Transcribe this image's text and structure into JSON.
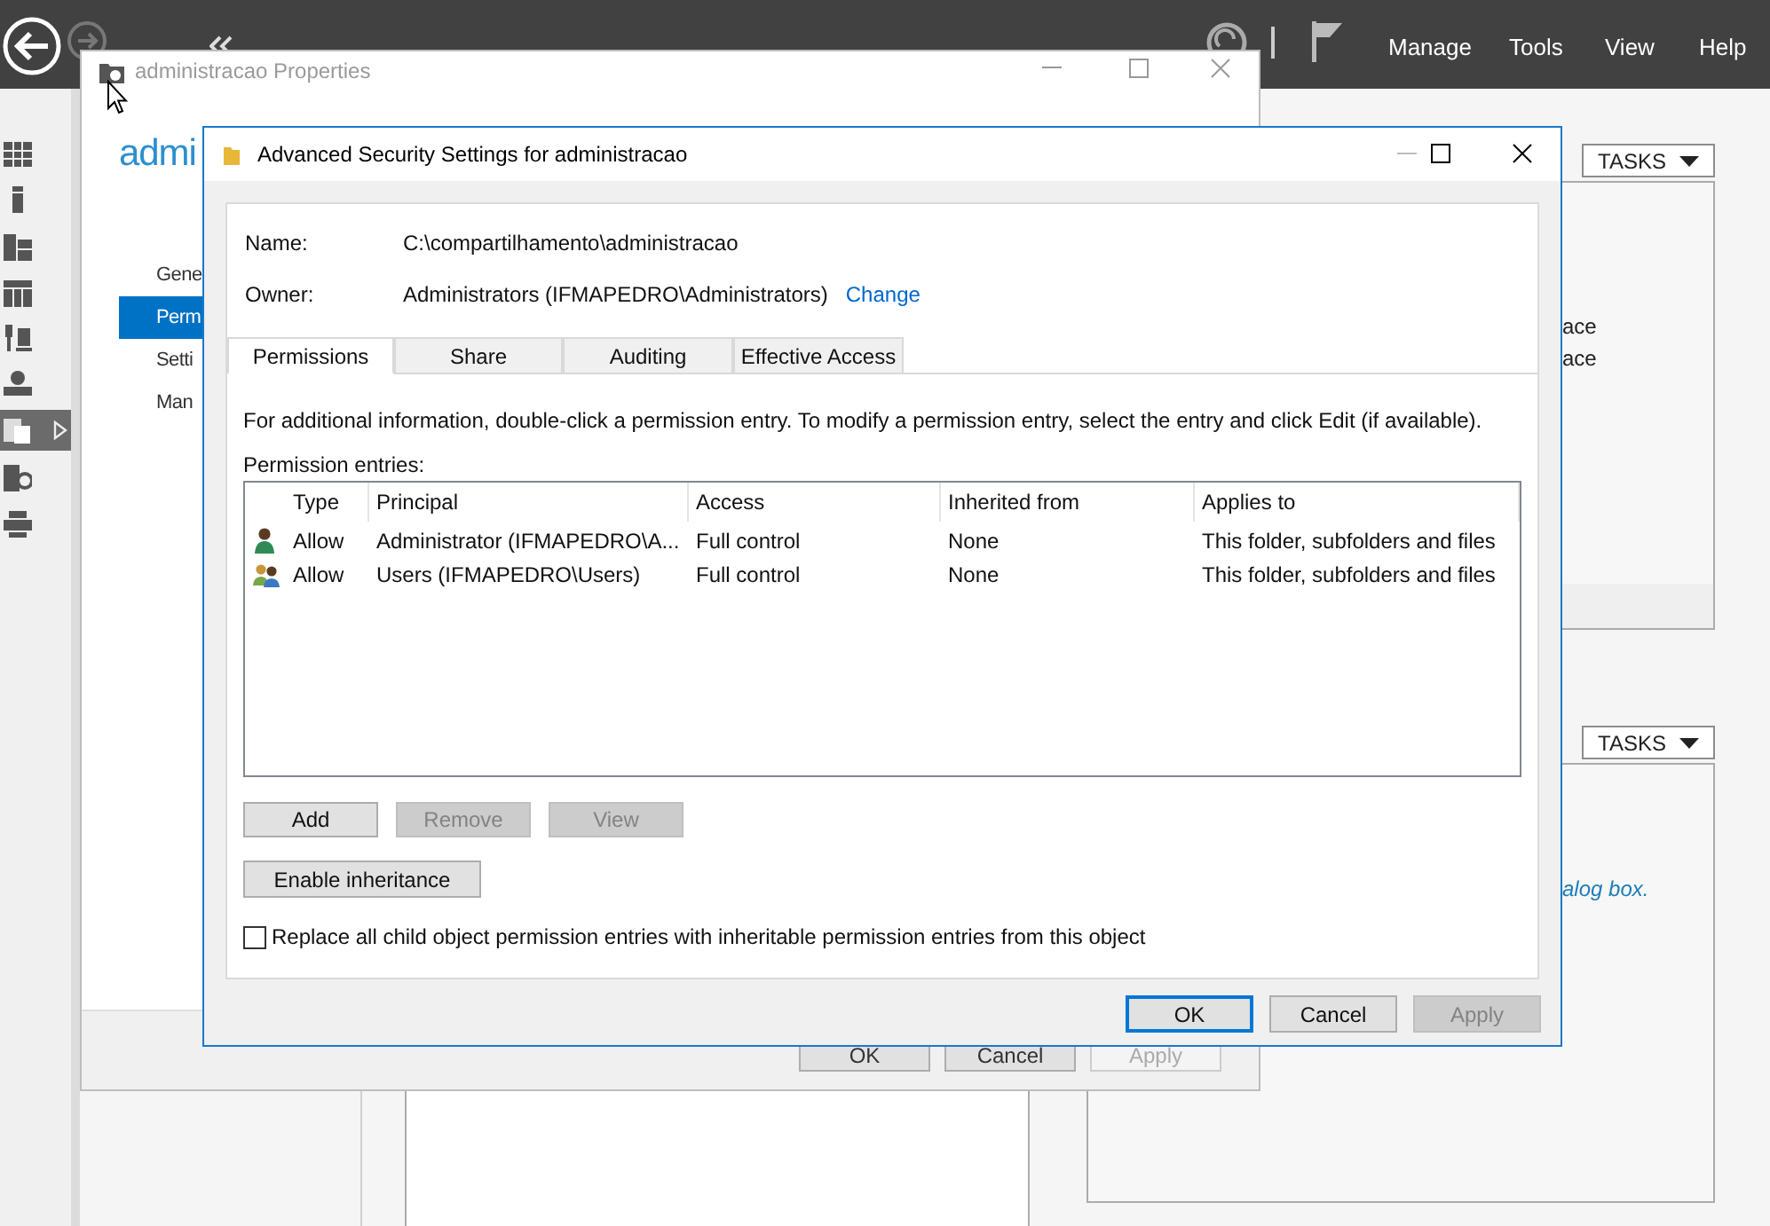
{
  "top_bar": {
    "menu": [
      "Manage",
      "Tools",
      "View",
      "Help"
    ]
  },
  "sidebar": {
    "items": [
      {
        "selected": false
      },
      {
        "selected": false
      },
      {
        "selected": false
      },
      {
        "selected": false
      },
      {
        "selected": false
      },
      {
        "selected": false
      },
      {
        "selected": true
      },
      {
        "selected": false
      },
      {
        "selected": false
      }
    ]
  },
  "right_panels": [
    {
      "tasks": "TASKS",
      "texts": [
        "ace",
        "ace"
      ],
      "kind": "text"
    },
    {
      "tasks": "TASKS",
      "texts": [
        "alog box."
      ],
      "kind": "link"
    }
  ],
  "properties_window": {
    "title": "administracao Properties",
    "active": false,
    "heading": "admi",
    "nav": [
      {
        "label": "Gene",
        "selected": false
      },
      {
        "label": "Perm",
        "selected": true
      },
      {
        "label": "Setti",
        "selected": false
      },
      {
        "label": "Man",
        "selected": false
      }
    ],
    "buttons": [
      {
        "label": "OK",
        "disabled": false
      },
      {
        "label": "Cancel",
        "disabled": false
      },
      {
        "label": "Apply",
        "disabled": true
      }
    ]
  },
  "dialog": {
    "title": "Advanced Security Settings for administracao",
    "name_label": "Name:",
    "name_value": "C:\\compartilhamento\\administracao",
    "owner_label": "Owner:",
    "owner_value": "Administrators (IFMAPEDRO\\Administrators)",
    "change_link": "Change",
    "tabs": [
      {
        "label": "Permissions",
        "selected": true
      },
      {
        "label": "Share",
        "selected": false
      },
      {
        "label": "Auditing",
        "selected": false
      },
      {
        "label": "Effective Access",
        "selected": false
      }
    ],
    "info": "For additional information, double-click a permission entry. To modify a permission entry, select the entry and click Edit (if available).",
    "entries_label": "Permission entries:",
    "columns": [
      "Type",
      "Principal",
      "Access",
      "Inherited from",
      "Applies to"
    ],
    "rows": [
      {
        "kind": "user",
        "cells": [
          "Allow",
          "Administrator (IFMAPEDRO\\A...",
          "Full control",
          "None",
          "This folder, subfolders and files"
        ]
      },
      {
        "kind": "group",
        "cells": [
          "Allow",
          "Users (IFMAPEDRO\\Users)",
          "Full control",
          "None",
          "This folder, subfolders and files"
        ]
      }
    ],
    "entry_buttons": [
      {
        "label": "Add",
        "disabled": false
      },
      {
        "label": "Remove",
        "disabled": true
      },
      {
        "label": "View",
        "disabled": true
      }
    ],
    "enable_inheritance": "Enable inheritance",
    "replace_checkbox": {
      "label": "Replace all child object permission entries with inheritable permission entries from this object",
      "checked": false
    },
    "buttons": [
      {
        "label": "OK",
        "disabled": false,
        "default": true
      },
      {
        "label": "Cancel",
        "disabled": false,
        "default": false
      },
      {
        "label": "Apply",
        "disabled": true,
        "default": false
      }
    ]
  }
}
